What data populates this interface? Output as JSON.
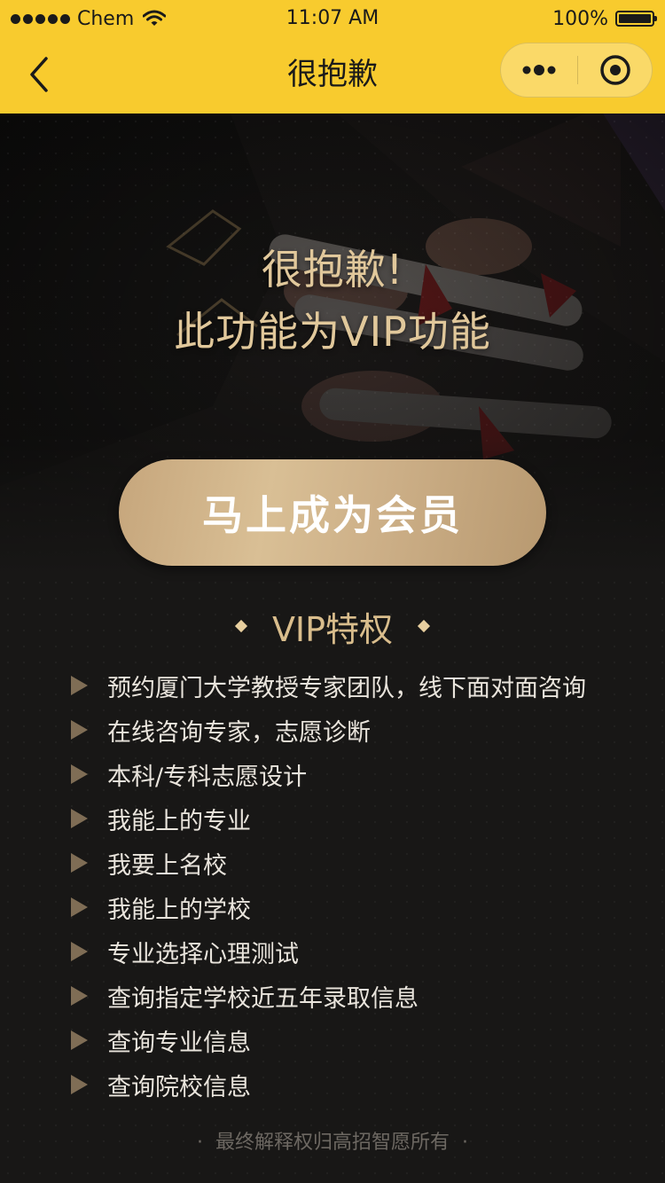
{
  "status_bar": {
    "carrier": "Chem",
    "time": "11:07 AM",
    "battery": "100%"
  },
  "nav": {
    "title": "很抱歉",
    "back_icon": "chevron-left-icon",
    "more_icon": "more-dots-icon",
    "close_icon": "target-close-icon",
    "bar_color": "#f8cb2e"
  },
  "hero": {
    "line1": "很抱歉!",
    "line2": "此功能为VIP功能",
    "cta_label": "马上成为会员",
    "title_color": "#e1c89b"
  },
  "privileges": {
    "title": "VIP特权",
    "items": [
      "预约厦门大学教授专家团队，线下面对面咨询",
      "在线咨询专家，志愿诊断",
      "本科/专科志愿设计",
      "我能上的专业",
      "我要上名校",
      "我能上的学校",
      "专业选择心理测试",
      "查询指定学校近五年录取信息",
      "查询专业信息",
      "查询院校信息"
    ]
  },
  "footer": {
    "note": "最终解释权归高招智愿所有"
  }
}
